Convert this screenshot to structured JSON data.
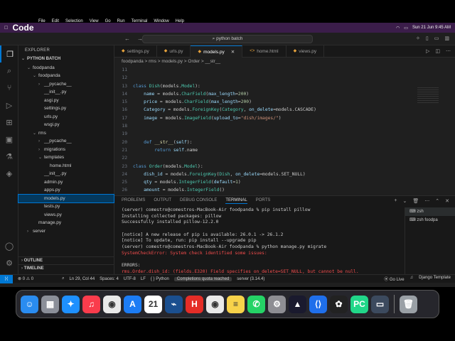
{
  "menubar": {
    "apple": "",
    "items": [
      "Code",
      "File",
      "Edit",
      "Selection",
      "View",
      "Go",
      "Run",
      "Terminal",
      "Window",
      "Help"
    ],
    "datetime": "Sun 21 Jun  9:45 AM"
  },
  "titlebar": {
    "search": "python batch"
  },
  "explorer": {
    "header": "EXPLORER",
    "root": "PYTHON BATCH",
    "tree": [
      {
        "label": "foodpanda",
        "indent": 1,
        "chev": "⌄"
      },
      {
        "label": "foodpanda",
        "indent": 2,
        "chev": "⌄"
      },
      {
        "label": "__pycache__",
        "indent": 3,
        "chev": "›"
      },
      {
        "label": "__init__.py",
        "indent": 3,
        "chev": ""
      },
      {
        "label": "asgi.py",
        "indent": 3,
        "chev": ""
      },
      {
        "label": "settings.py",
        "indent": 3,
        "chev": ""
      },
      {
        "label": "urls.py",
        "indent": 3,
        "chev": ""
      },
      {
        "label": "wsgi.py",
        "indent": 3,
        "chev": ""
      },
      {
        "label": "rms",
        "indent": 2,
        "chev": "⌄"
      },
      {
        "label": "__pycache__",
        "indent": 3,
        "chev": "›"
      },
      {
        "label": "migrations",
        "indent": 3,
        "chev": "›"
      },
      {
        "label": "templates",
        "indent": 3,
        "chev": "⌄"
      },
      {
        "label": "home.html",
        "indent": 4,
        "chev": ""
      },
      {
        "label": "__init__.py",
        "indent": 3,
        "chev": ""
      },
      {
        "label": "admin.py",
        "indent": 3,
        "chev": ""
      },
      {
        "label": "apps.py",
        "indent": 3,
        "chev": ""
      },
      {
        "label": "models.py",
        "indent": 3,
        "chev": "",
        "selected": true
      },
      {
        "label": "tests.py",
        "indent": 3,
        "chev": ""
      },
      {
        "label": "views.py",
        "indent": 3,
        "chev": ""
      },
      {
        "label": "manage.py",
        "indent": 2,
        "chev": ""
      },
      {
        "label": "server",
        "indent": 1,
        "chev": "›"
      }
    ],
    "outline": "OUTLINE",
    "timeline": "TIMELINE"
  },
  "tabs": [
    {
      "label": "settings.py",
      "active": false
    },
    {
      "label": "urls.py",
      "active": false
    },
    {
      "label": "models.py",
      "active": true
    },
    {
      "label": "home.html",
      "active": false
    },
    {
      "label": "views.py",
      "active": false
    }
  ],
  "breadcrumb": "foodpanda  >  rms  >  models.py  >  Order  >  __str__",
  "editor": {
    "lines": [
      {
        "n": "11",
        "html": ""
      },
      {
        "n": "12",
        "html": ""
      },
      {
        "n": "13",
        "html": "<span class='kw'>class</span> <span class='cls'>Dish</span>(models.<span class='cls'>Model</span>):"
      },
      {
        "n": "14",
        "html": "    <span class='prm'>name</span> = models.<span class='cls'>CharField</span>(<span class='prm'>max_length</span>=<span class='num'>200</span>)"
      },
      {
        "n": "15",
        "html": "    <span class='prm'>price</span> = models.<span class='cls'>CharField</span>(<span class='prm'>max_length</span>=<span class='num'>200</span>)"
      },
      {
        "n": "16",
        "html": "    <span class='prm'>Category</span> = models.<span class='cls'>ForeignKey</span>(<span class='cls'>Category</span>, <span class='prm'>on_delete</span>=models.CASCADE)"
      },
      {
        "n": "17",
        "html": "    <span class='prm'>image</span> = models.<span class='cls'>ImageField</span>(<span class='prm'>upload_to</span>=<span class='str'>\"dish/images/\"</span>)"
      },
      {
        "n": "18",
        "html": ""
      },
      {
        "n": "19",
        "html": ""
      },
      {
        "n": "20",
        "html": "    <span class='kw'>def</span> <span class='fn'>__str__</span>(<span class='prm'>self</span>):"
      },
      {
        "n": "21",
        "html": "        <span class='kw'>return</span> <span class='prm'>self</span>.name"
      },
      {
        "n": "22",
        "html": ""
      },
      {
        "n": "23",
        "html": "<span class='kw'>class</span> <span class='cls'>Order</span>(models.<span class='cls'>Model</span>):"
      },
      {
        "n": "24",
        "html": "    <span class='prm'>dish_id</span> = models.<span class='cls'>ForeignKey</span>(<span class='cls'>Dish</span>, <span class='prm'>on_delete</span>=models.SET_NULL)"
      },
      {
        "n": "25",
        "html": "    <span class='prm'>qty</span> = models.<span class='cls'>IntegerField</span>(<span class='prm'>default</span>=<span class='num'>1</span>)"
      },
      {
        "n": "26",
        "html": "    <span class='prm'>amount</span> = models.<span class='cls'>IntegerField</span>()"
      },
      {
        "n": "27",
        "html": ""
      },
      {
        "n": "28",
        "html": "    <span class='kw'>def</span> <span class='fn'>__str__</span>(<span class='prm'>self</span>):"
      },
      {
        "n": "29",
        "html": "        <span class='kw'>return</span> <span class='prm'>self</span>.dish_id.name + <span class='str'>\" - \"</span> + <span class='fn'>str</span>(<span class='prm'>self</span>.qty)",
        "current": true
      }
    ]
  },
  "panel": {
    "tabs": [
      {
        "label": "PROBLEMS",
        "active": false
      },
      {
        "label": "OUTPUT",
        "active": false
      },
      {
        "label": "DEBUG CONSOLE",
        "active": false
      },
      {
        "label": "TERMINAL",
        "active": true
      },
      {
        "label": "PORTS",
        "active": false
      }
    ],
    "terminal": [
      {
        "t": "(server) comestro@comestros-MacBook-Air foodpanda % pip install pillow",
        "c": ""
      },
      {
        "t": "Installing collected packages: pillow",
        "c": ""
      },
      {
        "t": "Successfully installed pillow-12.2.0",
        "c": ""
      },
      {
        "t": "",
        "c": ""
      },
      {
        "t": "[notice] A new release of pip is available: 26.0.1 -> 26.1.2",
        "c": ""
      },
      {
        "t": "[notice] To update, run: pip install --upgrade pip",
        "c": ""
      },
      {
        "t": "(server) comestro@comestros-MacBook-Air foodpanda % python manage.py migrate",
        "c": ""
      },
      {
        "t": "SystemCheckError: System check identified some issues:",
        "c": "err"
      },
      {
        "t": "",
        "c": ""
      },
      {
        "t": "ERRORS:",
        "c": ""
      },
      {
        "t": "rms.Order.dish_id: (fields.E320) Field specifies on_delete=SET_NULL, but cannot be null.",
        "c": "err"
      },
      {
        "t": "        HINT: Set null=True argument on the field, or change the on_delete rule.",
        "c": "err"
      },
      {
        "t": "(server) comestro@comestros-MacBook-Air foodpanda % ",
        "c": "",
        "cursor": true
      }
    ],
    "sessions": [
      "zsh",
      "zsh  foodpa"
    ]
  },
  "statusbar": {
    "errors": "⊗ 0  ⚠ 0",
    "position": "Ln 29, Col 44",
    "spaces": "Spaces: 4",
    "encoding": "UTF-8",
    "eol": "LF",
    "language": "Python",
    "quota": "Completions quota reached",
    "interpreter": "server (3.14.4)",
    "golive": "Go Live",
    "template": "Django Template"
  },
  "dock": {
    "apps": [
      {
        "name": "finder-icon",
        "glyph": "☺",
        "bg": "#2a8cf0"
      },
      {
        "name": "launchpad-icon",
        "glyph": "▦",
        "bg": "#8b8f99"
      },
      {
        "name": "safari-icon",
        "glyph": "✦",
        "bg": "#1e90ff"
      },
      {
        "name": "music-icon",
        "glyph": "♫",
        "bg": "#fa3c4c"
      },
      {
        "name": "chrome-icon",
        "glyph": "◉",
        "bg": "#e9e9e9"
      },
      {
        "name": "appstore-icon",
        "glyph": "A",
        "bg": "#1c7cf4"
      },
      {
        "name": "calendar-icon",
        "glyph": "21",
        "bg": "#ffffff"
      },
      {
        "name": "packet-tracer-icon",
        "glyph": "⌁",
        "bg": "#1b4f8f"
      },
      {
        "name": "h-app-icon",
        "glyph": "H",
        "bg": "#e52d27"
      },
      {
        "name": "chrome-icon-2",
        "glyph": "◉",
        "bg": "#e9e9e9"
      },
      {
        "name": "notes-icon",
        "glyph": "≡",
        "bg": "#f7d24a"
      },
      {
        "name": "whatsapp-icon",
        "glyph": "✆",
        "bg": "#25d366"
      },
      {
        "name": "settings-icon",
        "glyph": "⚙",
        "bg": "#8e8e93"
      },
      {
        "name": "arc-icon",
        "glyph": "▲",
        "bg": "#1a1a2e"
      },
      {
        "name": "vscode-icon",
        "glyph": "⟨⟩",
        "bg": "#1f6feb"
      },
      {
        "name": "chatgpt-icon",
        "glyph": "✿",
        "bg": "#222222"
      },
      {
        "name": "pycharm-icon",
        "glyph": "PC",
        "bg": "#21d789"
      },
      {
        "name": "screen-icon",
        "glyph": "▭",
        "bg": "#3c4a5e"
      }
    ],
    "trash": {
      "name": "trash-icon",
      "glyph": "🗑",
      "bg": "#9aa0a6"
    }
  }
}
